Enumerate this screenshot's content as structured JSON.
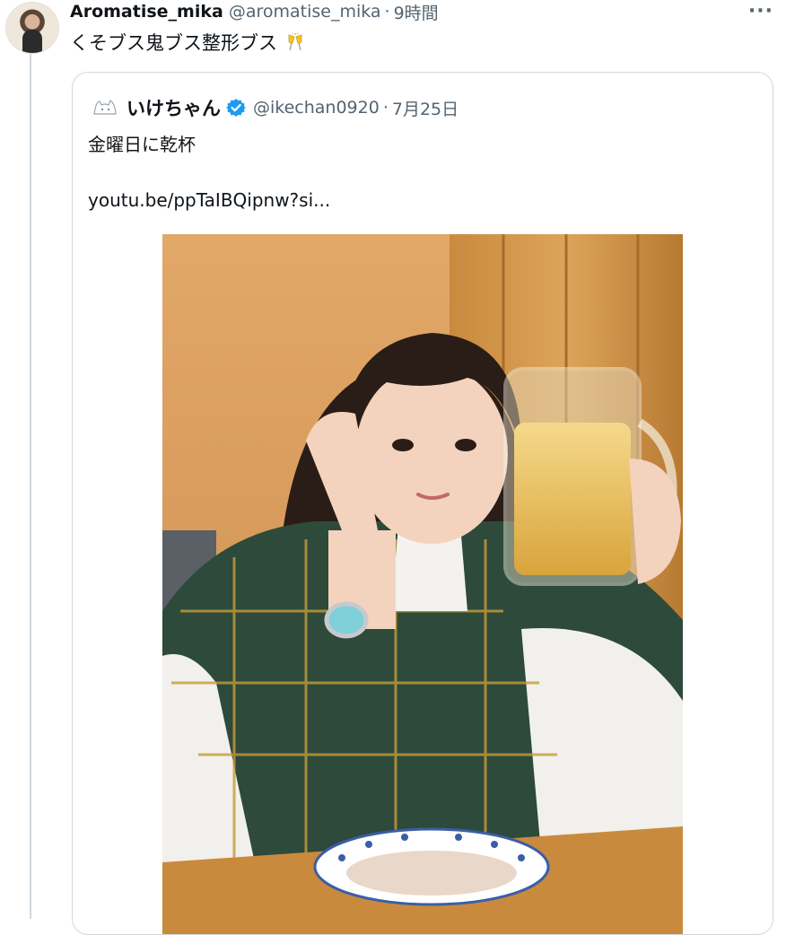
{
  "tweet": {
    "author_name": "Aromatise_mika",
    "author_handle": "@aromatise_mika",
    "separator": "·",
    "time": "9時間",
    "text": "くそブス鬼ブス整形ブス",
    "emoji_icon": "champagne-toast-icon",
    "more_label": "···"
  },
  "quoted_tweet": {
    "author_name": "いけちゃん",
    "author_handle": "@ikechan0920",
    "separator": "·",
    "date": "7月25日",
    "text": "金曜日に乾杯",
    "link": "youtu.be/ppTaIBQipnw?si...",
    "verified_icon": "verified-badge-icon",
    "verified_color": "#1d9bf0"
  },
  "photo": {
    "subject": "woman-with-beer-mug-photo"
  }
}
